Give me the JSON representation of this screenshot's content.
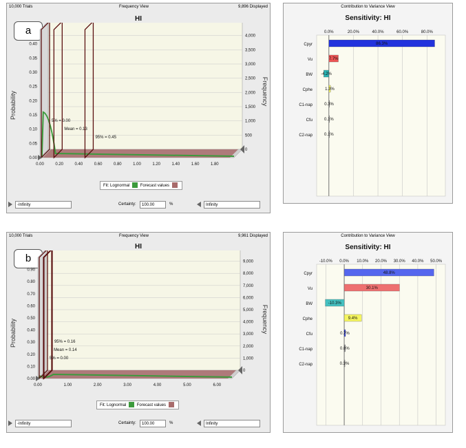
{
  "panels": [
    {
      "id": "a",
      "panel_label": "a",
      "trials": "10,000 Trials",
      "view": "Frequency View",
      "displayed": "9,896 Displayed",
      "title": "HI",
      "ylabel_left": "Probability",
      "ylabel_right": "Frequency",
      "legend": {
        "fit": "Fit: Lognormal",
        "forecast": "Forecast values"
      },
      "certainty_label": "Certainty:",
      "certainty_value": "100.00",
      "percent_sign": "%",
      "left_bound": "-Infinity",
      "right_bound": "Infinity"
    },
    {
      "id": "b",
      "panel_label": "b",
      "trials": "10,000 Trials",
      "view": "Frequency View",
      "displayed": "9,961 Displayed",
      "title": "HI",
      "ylabel_left": "Probability",
      "ylabel_right": "Frequency",
      "legend": {
        "fit": "Fit: Lognormal",
        "forecast": "Forecast values"
      },
      "certainty_label": "Certainty:",
      "certainty_value": "100.00",
      "percent_sign": "%",
      "left_bound": "-Infinity",
      "right_bound": "Infinity"
    }
  ],
  "sens_panels": [
    {
      "header": "Contribution to Variance View",
      "title": "Sensitivity: HI"
    },
    {
      "header": "Contribution to Variance View",
      "title": "Sensitivity: HI"
    }
  ],
  "colors": {
    "forecast": "#a86b6b",
    "fit": "#3c9a3c",
    "cpyr": "#2233dd",
    "vu": "#ee5555",
    "bw": "#2ab3b3",
    "cphe": "#f5f560",
    "cpyr_b": "#5566ee",
    "vu_b": "#ee7070",
    "bw_b": "#44c0c0"
  },
  "chart_data": [
    {
      "type": "bar",
      "panel": "a",
      "xlabel": "",
      "ylabel": "Probability",
      "y2label": "Frequency",
      "x_ticks": [
        "0.00",
        "0.20",
        "0.40",
        "0.60",
        "0.80",
        "1.00",
        "1.20",
        "1.40",
        "1.60",
        "1.80"
      ],
      "y_ticks": [
        "0.00",
        "0.05",
        "0.10",
        "0.15",
        "0.20",
        "0.25",
        "0.30",
        "0.35",
        "0.40"
      ],
      "y2_ticks": [
        "0",
        "500",
        "1,000",
        "1,500",
        "2,000",
        "2,500",
        "3,000",
        "3,500",
        "4,000"
      ],
      "xlim": [
        0,
        2.0
      ],
      "ylim": [
        0,
        0.45
      ],
      "markers": [
        {
          "label": "5% = 0.00",
          "x": 0.0
        },
        {
          "label": "Mean = 0.13",
          "x": 0.13
        },
        {
          "label": "95% = 0.45",
          "x": 0.45
        }
      ],
      "fit_peak": 0.16
    },
    {
      "type": "bar",
      "panel": "b",
      "xlabel": "",
      "ylabel": "Probability",
      "y2label": "Frequency",
      "x_ticks": [
        "0.00",
        "1.00",
        "2.00",
        "3.00",
        "4.00",
        "5.00",
        "6.00"
      ],
      "y_ticks": [
        "0.00",
        "0.10",
        "0.20",
        "0.30",
        "0.40",
        "0.50",
        "0.60",
        "0.70",
        "0.80",
        "0.90"
      ],
      "y2_ticks": [
        "0",
        "1,000",
        "2,000",
        "3,000",
        "4,000",
        "5,000",
        "6,000",
        "7,000",
        "8,000",
        "9,000"
      ],
      "xlim": [
        0,
        6.5
      ],
      "ylim": [
        0,
        1.0
      ],
      "markers": [
        {
          "label": "95% = 0.16",
          "x": 0.16
        },
        {
          "label": "Mean = 0.14",
          "x": 0.14
        },
        {
          "label": "5% = 0.00",
          "x": 0.0
        }
      ],
      "fit_peak": 0.02
    },
    {
      "type": "bar",
      "orientation": "horizontal",
      "panel": "a-sensitivity",
      "title": "Sensitivity: HI",
      "categories": [
        "Cpyr",
        "Vu",
        "BW",
        "Cphe",
        "C1-nap",
        "Cfu",
        "C2-nap"
      ],
      "values": [
        86.3,
        7.7,
        -4.2,
        1.3,
        0.3,
        0.1,
        0.1
      ],
      "labels": [
        "86.3%",
        "7.7%",
        "-4.2%",
        "1.3%",
        "0.3%",
        "0.1%",
        "0.1%"
      ],
      "x_ticks": [
        "0.0%",
        "20.0%",
        "40.0%",
        "60.0%",
        "80.0%"
      ],
      "xlim": [
        -10,
        95
      ]
    },
    {
      "type": "bar",
      "orientation": "horizontal",
      "panel": "b-sensitivity",
      "title": "Sensitivity: HI",
      "categories": [
        "Cpyr",
        "Vu",
        "BW",
        "Cphe",
        "Cfu",
        "C1-nap",
        "C2-nap"
      ],
      "values": [
        48.8,
        30.1,
        -10.3,
        9.4,
        0.7,
        0.6,
        0.3
      ],
      "labels": [
        "48.8%",
        "30.1%",
        "-10.3%",
        "9.4%",
        "0.7%",
        "0.6%",
        "0.3%"
      ],
      "x_ticks": [
        "-10.0%",
        "0.0%",
        "10.0%",
        "20.0%",
        "30.0%",
        "40.0%",
        "50.0%"
      ],
      "xlim": [
        -15,
        55
      ]
    }
  ]
}
